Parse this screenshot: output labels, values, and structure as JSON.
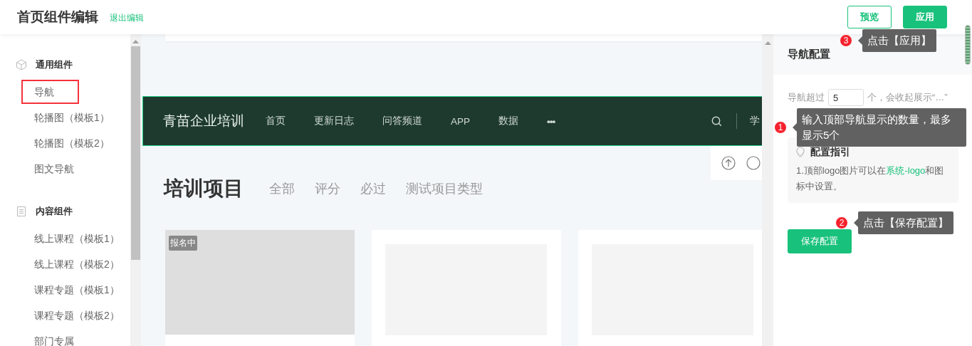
{
  "header": {
    "title": "首页组件编辑",
    "exit_link": "退出编辑",
    "buttons": [
      {
        "label": "预览",
        "kind": "outline"
      },
      {
        "label": "应用",
        "kind": "primary"
      }
    ],
    "tip": {
      "number": "3",
      "text": "点击【应用】"
    }
  },
  "sidebar": {
    "groups": [
      {
        "title": "通用组件",
        "items": [
          {
            "label": "导航",
            "selected": true
          },
          {
            "label": "轮播图（模板1）",
            "selected": false
          },
          {
            "label": "轮播图（模板2）",
            "selected": false
          },
          {
            "label": "图文导航",
            "selected": false
          }
        ]
      },
      {
        "title": "内容组件",
        "items": [
          {
            "label": "线上课程（模板1）",
            "selected": false
          },
          {
            "label": "线上课程（模板2）",
            "selected": false
          },
          {
            "label": "课程专题（模板1）",
            "selected": false
          },
          {
            "label": "课程专题（模板2）",
            "selected": false
          },
          {
            "label": "部门专属",
            "selected": false
          }
        ]
      }
    ]
  },
  "preview": {
    "nav": {
      "logo": "青苗企业培训",
      "items": [
        "首页",
        "更新日志",
        "问答频道",
        "APP",
        "数据"
      ],
      "more": "•••",
      "right_label": "学"
    },
    "heading": "培训项目",
    "filters": [
      "全部",
      "评分",
      "必过",
      "测试项目类型"
    ],
    "cards": [
      {
        "kind": "image",
        "badge": "报名中"
      },
      {
        "kind": "placeholder"
      },
      {
        "kind": "placeholder"
      }
    ]
  },
  "config": {
    "title": "导航配置",
    "nav_limit": {
      "prefix": "导航超过",
      "value": "5",
      "suffix": "个，会收起展示“…”",
      "tip": {
        "number": "1",
        "text": "输入顶部导航显示的数量，最多显示5个"
      }
    },
    "guide": {
      "title": "配置指引",
      "text": [
        {
          "kind": "text",
          "text": "1.顶部logo图片可以在"
        },
        {
          "kind": "link",
          "text": "系统-logo"
        },
        {
          "kind": "text",
          "text": "和图标中设置。"
        }
      ]
    },
    "save_button": "保存配置",
    "save_tip": {
      "number": "2",
      "text": "点击【保存配置】"
    }
  }
}
